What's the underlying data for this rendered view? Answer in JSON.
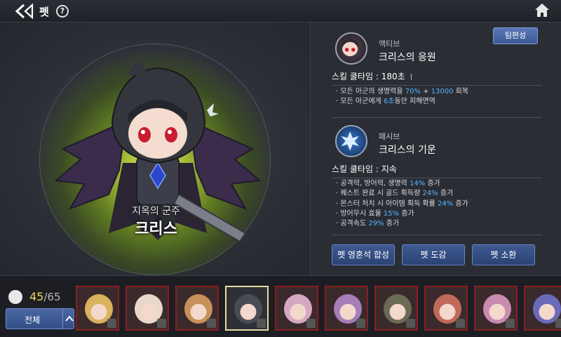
{
  "header": {
    "title": "펫",
    "help_label": "?"
  },
  "pet": {
    "subtitle": "지옥의 군주",
    "name": "크리스"
  },
  "team_button": "팀편성",
  "active_skill": {
    "type": "액티브",
    "name": "크리스의 응원",
    "cooldown_label": "스킬 쿨타임 :",
    "cooldown_value": "180초",
    "lines": [
      {
        "pre": "· 모든 아군의 생명력을 ",
        "hl": "70%",
        "post": " + ",
        "hl2": "13000",
        "post2": " 회복"
      },
      {
        "pre": "· 모든 아군에게 ",
        "hl": "6초",
        "post": "동안 피해면역",
        "hl2": "",
        "post2": ""
      }
    ]
  },
  "passive_skill": {
    "type": "패시브",
    "name": "크리스의 기운",
    "cooldown_label": "스킬 쿨타임 :",
    "cooldown_value": "지속",
    "lines": [
      {
        "pre": "· 공격력, 방어력, 생명력 ",
        "hl": "14%",
        "post": " 증가"
      },
      {
        "pre": "· 퀘스트 완료 시 골드 획득량 ",
        "hl": "24%",
        "post": " 증가"
      },
      {
        "pre": "· 몬스터 처치 시 아이템 획득 확률 ",
        "hl": "24%",
        "post": " 증가"
      },
      {
        "pre": "· 방어무시 효율 ",
        "hl": "15%",
        "post": " 증가"
      },
      {
        "pre": "· 공격속도 ",
        "hl": "29%",
        "post": " 증가"
      }
    ]
  },
  "actions": {
    "fuse": "펫 영혼석 합성",
    "codex": "펫 도감",
    "summon": "펫 소환"
  },
  "collection": {
    "current": "45",
    "separator": "/",
    "max": "65",
    "filter_label": "전체"
  },
  "slots": [
    {
      "color": "#d9b25c"
    },
    {
      "color": "#e9d7c9"
    },
    {
      "color": "#c8905a"
    },
    {
      "color": "#4a4c55"
    },
    {
      "color": "#d6a7c2"
    },
    {
      "color": "#a67db8"
    },
    {
      "color": "#6a6a55"
    },
    {
      "color": "#c0695a"
    },
    {
      "color": "#c98bb0"
    },
    {
      "color": "#6a6ab8"
    }
  ],
  "colors": {
    "accent_blue": "#58b4ff",
    "count_yellow": "#f2d25a",
    "slot_border": "#8b1e1e",
    "selected_border": "#e8dca2"
  }
}
